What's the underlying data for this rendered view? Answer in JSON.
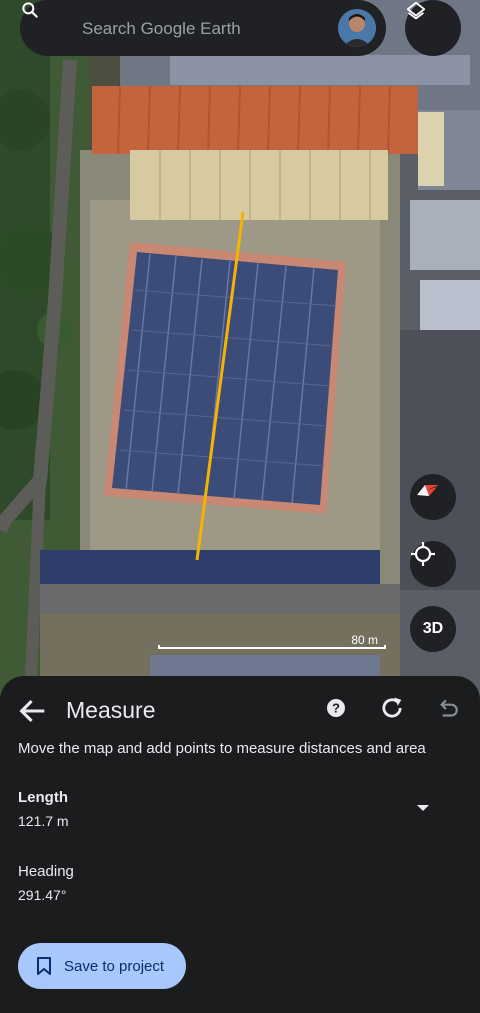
{
  "search": {
    "placeholder": "Search Google Earth"
  },
  "map": {
    "scale_label": "80 m",
    "measure_line_color": "#f4b400",
    "buttons": {
      "three_d_label": "3D"
    },
    "icons": [
      "search-icon",
      "layers-icon",
      "compass-icon",
      "my-location-icon"
    ]
  },
  "measure": {
    "title": "Measure",
    "instruction": "Move the map and add points to measure distances and area",
    "length_label": "Length",
    "length_value": "121.7 m",
    "heading_label": "Heading",
    "heading_value": "291.47°",
    "save_label": "Save to project",
    "icons": [
      "back-arrow-icon",
      "help-icon",
      "redo-icon",
      "undo-icon",
      "chevron-down-icon",
      "bookmark-icon"
    ]
  },
  "colors": {
    "sheet_bg": "#1b1c1e",
    "save_button_bg": "#a8c7fa",
    "accent_line": "#f4b400"
  }
}
